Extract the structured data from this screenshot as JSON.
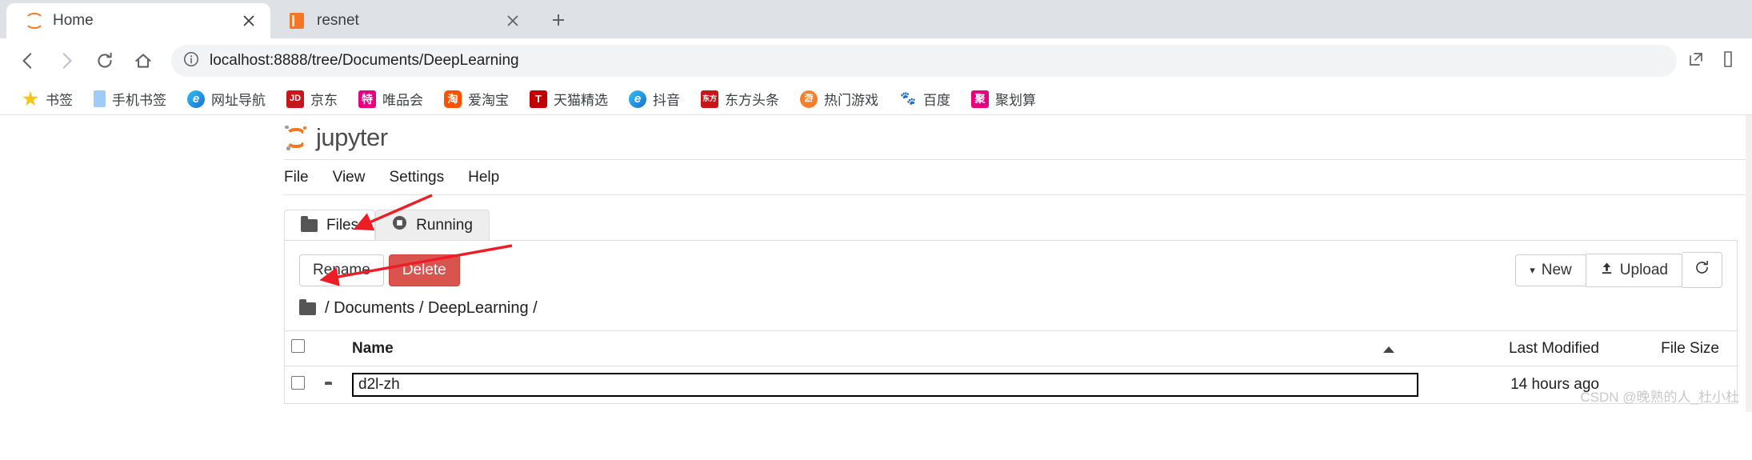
{
  "browser": {
    "tabs": [
      {
        "title": "Home",
        "favicon": "jupyter-logo-icon",
        "active": true,
        "close_label": "✕"
      },
      {
        "title": "resnet",
        "favicon": "notebook-icon",
        "active": false,
        "close_label": "✕"
      }
    ],
    "new_tab_label": "+",
    "nav": {
      "back_label": "‹",
      "forward_label": "›",
      "reload_label": "⟳",
      "home_label": "⌂"
    },
    "omnibox": {
      "info_icon": "site-info-icon",
      "url": "localhost:8888/tree/Documents/DeepLearning",
      "share_icon": "open-external-icon"
    },
    "bookmarks": [
      {
        "label": "书签",
        "icon": "star-icon",
        "color": "#f5c518",
        "glyph": "★"
      },
      {
        "label": "手机书签",
        "icon": "phone-icon",
        "color": "#9ecbfa",
        "glyph": ""
      },
      {
        "label": "网址导航",
        "icon": "ie-icon",
        "color": "#1ba1e2",
        "glyph": "e"
      },
      {
        "label": "京东",
        "icon": "jd-icon",
        "color": "#c8161d",
        "glyph": "JD"
      },
      {
        "label": "唯品会",
        "icon": "vip-icon",
        "color": "#e4007f",
        "glyph": "特"
      },
      {
        "label": "爱淘宝",
        "icon": "taobao-icon",
        "color": "#ff5000",
        "glyph": "淘"
      },
      {
        "label": "天猫精选",
        "icon": "tmall-icon",
        "color": "#c20000",
        "glyph": "T"
      },
      {
        "label": "抖音",
        "icon": "douyin-icon",
        "color": "#1ba1e2",
        "glyph": "e"
      },
      {
        "label": "东方头条",
        "icon": "dongfang-icon",
        "color": "#c8161d",
        "glyph": "东方"
      },
      {
        "label": "热门游戏",
        "icon": "games-icon",
        "color": "#f5802a",
        "glyph": "游"
      },
      {
        "label": "百度",
        "icon": "baidu-icon",
        "color": "#2932e1",
        "glyph": "du"
      },
      {
        "label": "聚划算",
        "icon": "juhuasuan-icon",
        "color": "#e4007f",
        "glyph": "聚"
      }
    ]
  },
  "jupyter": {
    "brand": "jupyter",
    "menu": [
      "File",
      "View",
      "Settings",
      "Help"
    ],
    "tabs": [
      {
        "label": "Files",
        "icon": "folder-icon",
        "active": true
      },
      {
        "label": "Running",
        "icon": "stop-circle-icon",
        "active": false
      }
    ],
    "toolbar": {
      "rename_label": "Rename",
      "delete_label": "Delete",
      "new_label": "New",
      "new_caret": "▾",
      "upload_label": "Upload",
      "upload_icon": "upload-arrow-icon",
      "refresh_icon": "refresh-icon",
      "refresh_label": "⟳"
    },
    "breadcrumb": {
      "icon": "folder-icon",
      "parts": [
        "/",
        "Documents",
        "/",
        "DeepLearning",
        "/"
      ],
      "text": "/ Documents / DeepLearning /"
    },
    "table": {
      "headers": {
        "name": "Name",
        "sort_indicator": "sort-ascending-icon",
        "last_modified": "Last Modified",
        "file_size": "File Size"
      },
      "rows": [
        {
          "checkbox": "unchecked",
          "icon": "folder-icon",
          "name": "d2l-zh",
          "name_editing": true,
          "last_modified": "14 hours ago",
          "file_size": ""
        }
      ]
    }
  },
  "annotations": {
    "arrow_color": "#ee1c25",
    "arrow_breadcrumb": "arrow-pointing-to-breadcrumb",
    "arrow_name_field": "arrow-pointing-to-name-edit"
  },
  "watermark": "CSDN @晚熟的人_杜小杜"
}
